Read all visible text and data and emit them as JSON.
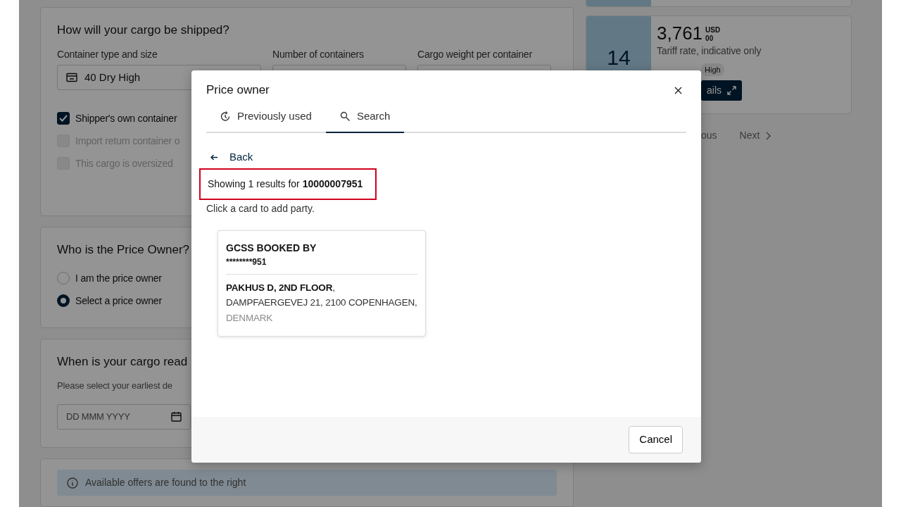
{
  "shipping": {
    "title": "How will your cargo be shipped?",
    "fields": [
      {
        "label": "Container type and size",
        "value": "40 Dry High"
      },
      {
        "label": "Number of containers"
      },
      {
        "label": "Cargo weight per container"
      }
    ],
    "options": [
      {
        "label": "Shipper's own container",
        "checked": true,
        "disabled": false
      },
      {
        "label": "Import return container o",
        "checked": false,
        "disabled": true
      },
      {
        "label": "This cargo is oversized",
        "checked": false,
        "disabled": true
      }
    ]
  },
  "price_owner": {
    "title": "Who is the Price Owner?",
    "options": [
      {
        "label": "I am the price owner",
        "selected": false
      },
      {
        "label": "Select a price owner",
        "selected": true
      }
    ]
  },
  "readiness": {
    "title": "When is your cargo read",
    "hint": "Please select your earliest de",
    "date_placeholder": "DD MMM YYYY"
  },
  "offers_notice": "Available offers are found to the right",
  "offer": {
    "days": "14",
    "price": "3,761",
    "currency": "USD",
    "cents": "00",
    "note": "Tariff rate, indicative only",
    "tag": "High",
    "button": "ails"
  },
  "pagination": {
    "previous": "ous",
    "next": "Next"
  },
  "modal": {
    "title": "Price owner",
    "tabs": [
      {
        "label": "Previously used",
        "selected": false
      },
      {
        "label": "Search",
        "selected": true
      }
    ],
    "back": "Back",
    "results": "Showing 1 results for **10000007951**",
    "results_highlighted": true,
    "hint": "Click a card to add party.",
    "parties": [
      {
        "name": "GCSS BOOKED BY",
        "id": "********951",
        "address": [
          {
            "kind": "strong",
            "text": "PAKHUS D, 2ND FLOOR"
          },
          {
            "kind": "normal",
            "text": ", DAMPFAERGEVEJ 21, 2100 COPENHAGEN, "
          },
          {
            "kind": "muted",
            "text": "DENMARK"
          }
        ]
      }
    ],
    "cancel": "Cancel"
  }
}
